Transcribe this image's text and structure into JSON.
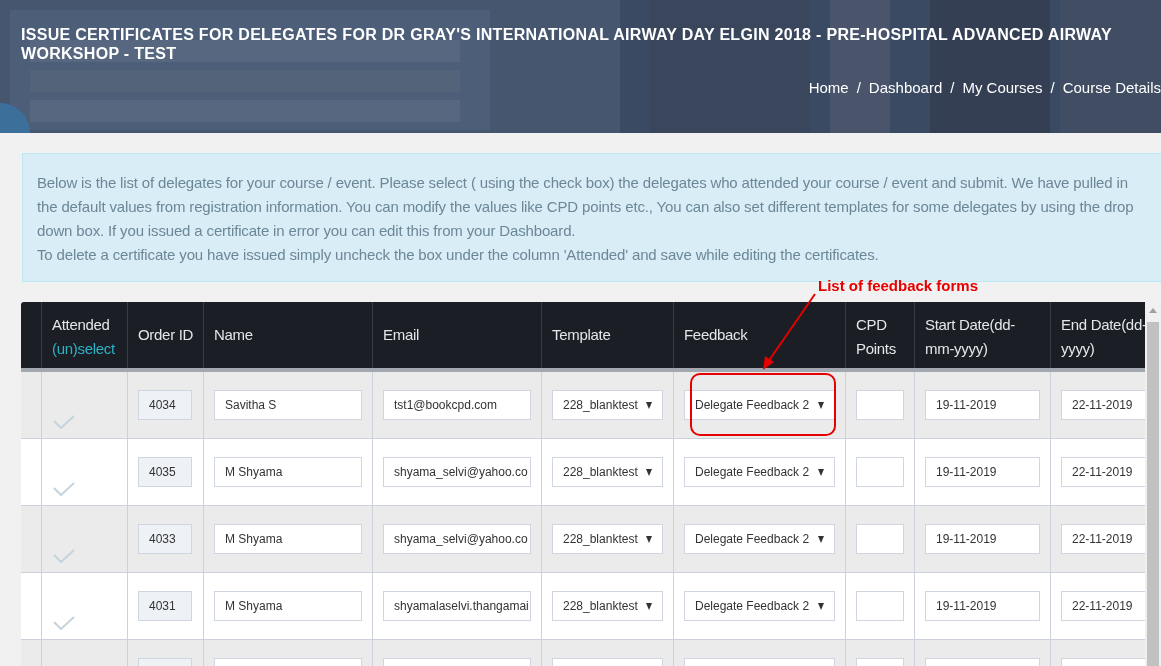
{
  "header": {
    "title": "ISSUE CERTIFICATES FOR DELEGATES FOR DR GRAY'S INTERNATIONAL AIRWAY DAY ELGIN 2018 - PRE-HOSPITAL ADVANCED AIRWAY WORKSHOP - TEST",
    "breadcrumb": [
      {
        "label": "Home"
      },
      {
        "label": "Dashboard"
      },
      {
        "label": "My Courses"
      },
      {
        "label": "Course Details"
      }
    ],
    "separator": "/"
  },
  "notice": {
    "paragraphs": [
      "Below is the list of delegates for your course / event. Please select ( using the check box) the delegates who attended your course / event and submit. We have pulled in the default values from registration information. You can modify the values like CPD points etc., You can also set different templates for some delegates by using the drop down box. If you issued a certificate in error you can edit this from your Dashboard.",
      "To delete a certificate you have issued simply uncheck the box under the column 'Attended' and save while editing the certificates."
    ]
  },
  "annotation": {
    "text": "List of feedback forms"
  },
  "table": {
    "columns": [
      {
        "label": "Attended",
        "link": "(un)select"
      },
      {
        "label": "Order ID"
      },
      {
        "label": "Name"
      },
      {
        "label": "Email"
      },
      {
        "label": "Template"
      },
      {
        "label": "Feedback"
      },
      {
        "label": "CPD Points"
      },
      {
        "label": "Start Date(dd-mm-yyyy)"
      },
      {
        "label": "End Date(dd-yyyy)"
      }
    ],
    "rows": [
      {
        "attended": true,
        "order_id": "4034",
        "name": "Savitha S",
        "email": "tst1@bookcpd.com",
        "template": "228_blanktest",
        "feedback": "Delegate Feedback 2",
        "start_date": "19-11-2019",
        "end_date": "22-11-2019",
        "highlighted": true
      },
      {
        "attended": true,
        "order_id": "4035",
        "name": "M Shyama",
        "email": "shyama_selvi@yahoo.co",
        "template": "228_blanktest",
        "feedback": "Delegate Feedback 2",
        "start_date": "19-11-2019",
        "end_date": "22-11-2019",
        "highlighted": false
      },
      {
        "attended": true,
        "order_id": "4033",
        "name": "M Shyama",
        "email": "shyama_selvi@yahoo.co",
        "template": "228_blanktest",
        "feedback": "Delegate Feedback 2",
        "start_date": "19-11-2019",
        "end_date": "22-11-2019",
        "highlighted": false
      },
      {
        "attended": true,
        "order_id": "4031",
        "name": "M Shyama",
        "email": "shyamalaselvi.thangamai",
        "template": "228_blanktest",
        "feedback": "Delegate Feedback 2",
        "start_date": "19-11-2019",
        "end_date": "22-11-2019",
        "highlighted": false
      }
    ]
  }
}
